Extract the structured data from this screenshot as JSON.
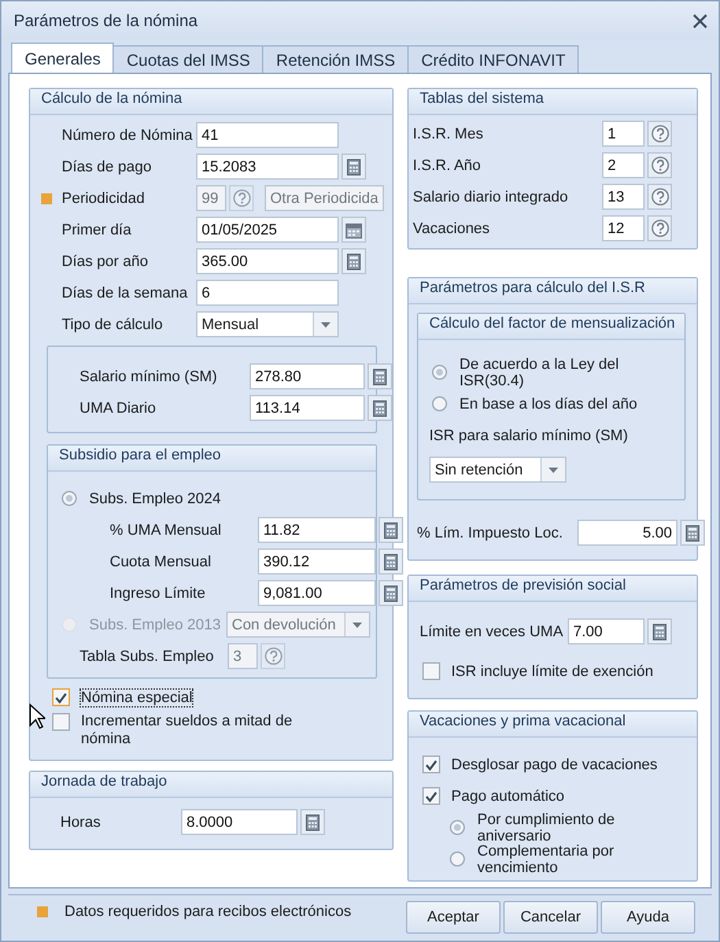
{
  "window": {
    "title": "Parámetros de la nómina"
  },
  "tabs": [
    {
      "label": "Generales",
      "selected": true
    },
    {
      "label": "Cuotas del IMSS",
      "selected": false
    },
    {
      "label": "Retención IMSS",
      "selected": false
    },
    {
      "label": "Crédito INFONAVIT",
      "selected": false
    }
  ],
  "calculo": {
    "title": "Cálculo de la nómina",
    "items": [
      {
        "kind": "text",
        "label": "Número de Nómina",
        "value": "41"
      },
      {
        "kind": "calc",
        "label": "Días de pago",
        "value": "15.2083"
      },
      {
        "kind": "code",
        "label": "Periodicidad",
        "value": "99",
        "description": "Otra Periodicida",
        "required": true,
        "disabled": true
      },
      {
        "kind": "calendar",
        "label": "Primer día",
        "value": "01/05/2025"
      },
      {
        "kind": "calc",
        "label": "Días por año",
        "value": "365.00"
      },
      {
        "kind": "text",
        "label": "Días de la semana",
        "value": "6"
      },
      {
        "kind": "select",
        "label": "Tipo de cálculo",
        "value": "Mensual"
      }
    ],
    "salario": [
      {
        "kind": "calc",
        "label": "Salario mínimo (SM)",
        "value": "278.80"
      },
      {
        "kind": "calc",
        "label": "UMA Diario",
        "value": "113.14"
      }
    ],
    "subsidio": {
      "title": "Subsidio para el empleo",
      "items": [
        {
          "kind": "radio",
          "label": "Subs. Empleo 2024",
          "selected": true,
          "disabled": false,
          "children": [
            {
              "kind": "calc",
              "label": "% UMA Mensual",
              "value": "11.82"
            },
            {
              "kind": "calc",
              "label": "Cuota Mensual",
              "value": "390.12"
            },
            {
              "kind": "calc",
              "label": "Ingreso Límite",
              "value": "9,081.00"
            }
          ]
        },
        {
          "kind": "radio_select",
          "label": "Subs. Empleo 2013",
          "selected": false,
          "disabled": true,
          "value": "Con devolución"
        },
        {
          "kind": "code",
          "label": "Tabla Subs. Empleo",
          "value": "3",
          "disabled": true
        }
      ]
    },
    "options": [
      {
        "kind": "checkbox",
        "label": "Nómina especial",
        "checked": true,
        "focused": true
      },
      {
        "kind": "checkbox",
        "label": "Incrementar sueldos a mitad de nómina",
        "checked": false,
        "focused": false
      }
    ]
  },
  "jornada": {
    "title": "Jornada de trabajo",
    "items": [
      {
        "kind": "calc",
        "label": "Horas",
        "value": "8.0000"
      }
    ]
  },
  "legend": {
    "label": "Datos requeridos para recibos electrónicos"
  },
  "tablas": {
    "title": "Tablas del sistema",
    "items": [
      {
        "kind": "code",
        "label": "I.S.R. Mes",
        "value": "1",
        "disabled": false
      },
      {
        "kind": "code",
        "label": "I.S.R. Año",
        "value": "2",
        "disabled": false
      },
      {
        "kind": "code",
        "label": "Salario diario integrado",
        "value": "13",
        "disabled": false
      },
      {
        "kind": "code",
        "label": "Vacaciones",
        "value": "12",
        "disabled": false
      }
    ]
  },
  "isr": {
    "title": "Parámetros para cálculo del I.S.R",
    "factor": {
      "title": "Cálculo del factor de mensualización",
      "items": [
        {
          "kind": "radio",
          "label": "De acuerdo a la Ley del ISR(30.4)",
          "selected": true,
          "disabled": false
        },
        {
          "kind": "radio",
          "label": "En base a los días del año",
          "selected": false,
          "disabled": false
        },
        {
          "kind": "label",
          "label": "ISR para salario mínimo (SM)"
        },
        {
          "kind": "select",
          "value": "Sin retención"
        }
      ]
    },
    "items": [
      {
        "kind": "amount",
        "label": "% Lím. Impuesto Loc.",
        "value": "5.00"
      }
    ]
  },
  "prevision": {
    "title": "Parámetros de previsión social",
    "items": [
      {
        "kind": "calc",
        "label": "Límite en veces UMA",
        "value": "7.00"
      },
      {
        "kind": "checkbox",
        "label": "ISR incluye límite de exención",
        "checked": false
      }
    ]
  },
  "vacaciones": {
    "title": "Vacaciones y prima vacacional",
    "items": [
      {
        "kind": "checkbox",
        "label": "Desglosar pago de vacaciones",
        "checked": true
      },
      {
        "kind": "checkbox",
        "label": "Pago automático",
        "checked": true,
        "children": [
          {
            "kind": "radio",
            "label": "Por cumplimiento de aniversario",
            "selected": true,
            "disabled": false
          },
          {
            "kind": "radio",
            "label": "Complementaria por vencimiento",
            "selected": false,
            "disabled": false
          }
        ]
      }
    ]
  },
  "buttons": [
    {
      "label": "Aceptar"
    },
    {
      "label": "Cancelar"
    },
    {
      "label": "Ayuda"
    }
  ]
}
